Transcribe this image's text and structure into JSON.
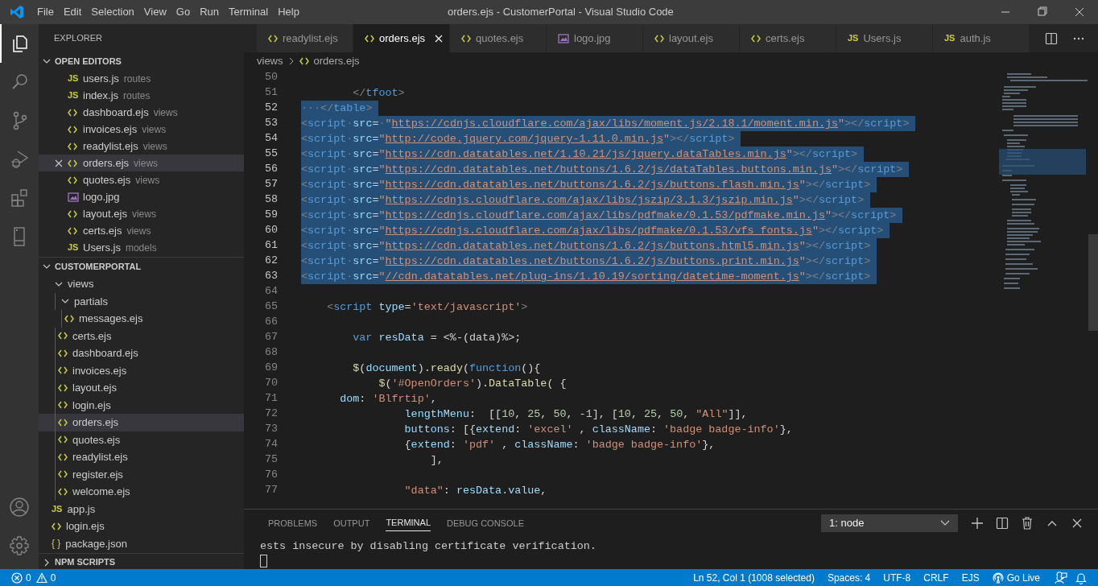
{
  "window": {
    "title": "orders.ejs - CustomerPortal - Visual Studio Code"
  },
  "menu": [
    "File",
    "Edit",
    "Selection",
    "View",
    "Go",
    "Run",
    "Terminal",
    "Help"
  ],
  "activity_bar": [
    {
      "kind": "explorer",
      "selected": true
    },
    {
      "kind": "search",
      "selected": false
    },
    {
      "kind": "source-control",
      "selected": false
    },
    {
      "kind": "run",
      "selected": false
    },
    {
      "kind": "extensions",
      "selected": false
    },
    {
      "kind": "remote",
      "selected": false
    }
  ],
  "activity_bar_bottom": [
    {
      "kind": "account"
    },
    {
      "kind": "settings"
    }
  ],
  "sidebar": {
    "title": "EXPLORER",
    "open_editors": {
      "title": "OPEN EDITORS",
      "expanded": true,
      "items": [
        {
          "label": "users.js",
          "folder": "routes",
          "kind": "js",
          "icon_label": "JS",
          "selected": false
        },
        {
          "label": "index.js",
          "folder": "routes",
          "kind": "js",
          "icon_label": "JS",
          "selected": false
        },
        {
          "label": "dashboard.ejs",
          "folder": "views",
          "kind": "ejs",
          "selected": false
        },
        {
          "label": "invoices.ejs",
          "folder": "views",
          "kind": "ejs",
          "selected": false
        },
        {
          "label": "readylist.ejs",
          "folder": "views",
          "kind": "ejs",
          "selected": false
        },
        {
          "label": "orders.ejs",
          "folder": "views",
          "kind": "ejs",
          "selected": true
        },
        {
          "label": "quotes.ejs",
          "folder": "views",
          "kind": "ejs",
          "selected": false
        },
        {
          "label": "logo.jpg",
          "kind": "image",
          "selected": false
        },
        {
          "label": "layout.ejs",
          "folder": "views",
          "kind": "ejs",
          "selected": false
        },
        {
          "label": "certs.ejs",
          "folder": "views",
          "kind": "ejs",
          "selected": false
        },
        {
          "label": "Users.js",
          "folder": "models",
          "kind": "js",
          "icon_label": "JS",
          "selected": false
        }
      ]
    },
    "project": {
      "title": "CUSTOMERPORTAL",
      "expanded": true,
      "tree": [
        {
          "label": "views",
          "kind": "folder",
          "expanded": true,
          "selected": false,
          "children": [
            {
              "label": "partials",
              "kind": "folder",
              "expanded": true,
              "selected": false,
              "children": [
                {
                  "label": "messages.ejs",
                  "kind": "ejs",
                  "selected": false
                }
              ]
            },
            {
              "label": "certs.ejs",
              "kind": "ejs",
              "selected": false
            },
            {
              "label": "dashboard.ejs",
              "kind": "ejs",
              "selected": false
            },
            {
              "label": "invoices.ejs",
              "kind": "ejs",
              "selected": false
            },
            {
              "label": "layout.ejs",
              "kind": "ejs",
              "selected": false
            },
            {
              "label": "login.ejs",
              "kind": "ejs",
              "selected": false
            },
            {
              "label": "orders.ejs",
              "kind": "ejs",
              "selected": true
            },
            {
              "label": "quotes.ejs",
              "kind": "ejs",
              "selected": false
            },
            {
              "label": "readylist.ejs",
              "kind": "ejs",
              "selected": false
            },
            {
              "label": "register.ejs",
              "kind": "ejs",
              "selected": false
            },
            {
              "label": "welcome.ejs",
              "kind": "ejs",
              "selected": false
            }
          ]
        },
        {
          "label": "app.js",
          "kind": "js",
          "icon_label": "JS",
          "selected": false
        },
        {
          "label": "login.ejs",
          "kind": "ejs",
          "selected": false
        },
        {
          "label": "package.json",
          "kind": "json",
          "icon_label": "{ }",
          "selected": false
        }
      ]
    },
    "npm_scripts": {
      "title": "NPM SCRIPTS",
      "expanded": false
    }
  },
  "tabs": [
    {
      "label": "readylist.ejs",
      "kind": "ejs",
      "selected": false
    },
    {
      "label": "orders.ejs",
      "kind": "ejs",
      "selected": true
    },
    {
      "label": "quotes.ejs",
      "kind": "ejs",
      "selected": false
    },
    {
      "label": "logo.jpg",
      "kind": "image",
      "selected": false
    },
    {
      "label": "layout.ejs",
      "kind": "ejs",
      "selected": false
    },
    {
      "label": "certs.ejs",
      "kind": "ejs",
      "selected": false
    },
    {
      "label": "Users.js",
      "kind": "js",
      "icon_label": "JS",
      "selected": false
    },
    {
      "label": "auth.js",
      "kind": "js",
      "icon_label": "JS",
      "selected": false
    }
  ],
  "breadcrumb": [
    "views",
    "orders.ejs"
  ],
  "editor": {
    "lines": [
      {
        "number": "50",
        "selected": false
      },
      {
        "number": "51",
        "selected": false,
        "tokens": [
          {
            "kind": "punct",
            "text": "        </"
          },
          {
            "kind": "tag",
            "text": "tfoot"
          },
          {
            "kind": "punct",
            "text": ">"
          }
        ]
      },
      {
        "number": "52",
        "selected": true,
        "tokens": [
          {
            "kind": "ws",
            "text": "···"
          },
          {
            "kind": "punct",
            "text": "</"
          },
          {
            "kind": "tag",
            "text": "table"
          },
          {
            "kind": "punct",
            "text": ">"
          }
        ]
      },
      {
        "number": "53",
        "selected": true,
        "tokens": [
          {
            "kind": "punct",
            "text": "<"
          },
          {
            "kind": "tag",
            "text": "script"
          },
          {
            "kind": "ws",
            "text": "·"
          },
          {
            "kind": "attr",
            "text": "src"
          },
          {
            "kind": "plain",
            "text": "="
          },
          {
            "kind": "ws",
            "text": "·"
          },
          {
            "kind": "str",
            "text": "\""
          },
          {
            "kind": "url",
            "text": "https://cdnjs.cloudflare.com/ajax/libs/moment.js/2.18.1/moment.min.js"
          },
          {
            "kind": "str",
            "text": "\""
          },
          {
            "kind": "punct",
            "text": "></"
          },
          {
            "kind": "tag",
            "text": "script"
          },
          {
            "kind": "punct",
            "text": ">"
          }
        ]
      },
      {
        "number": "54",
        "selected": true,
        "tokens": [
          {
            "kind": "punct",
            "text": "<"
          },
          {
            "kind": "tag",
            "text": "script"
          },
          {
            "kind": "ws",
            "text": "·"
          },
          {
            "kind": "attr",
            "text": "src"
          },
          {
            "kind": "plain",
            "text": "="
          },
          {
            "kind": "str",
            "text": "\""
          },
          {
            "kind": "url",
            "text": "http://code.jquery.com/jquery-1.11.0.min.js"
          },
          {
            "kind": "str",
            "text": "\""
          },
          {
            "kind": "punct",
            "text": "></"
          },
          {
            "kind": "tag",
            "text": "script"
          },
          {
            "kind": "punct",
            "text": ">"
          }
        ]
      },
      {
        "number": "55",
        "selected": true,
        "tokens": [
          {
            "kind": "punct",
            "text": "<"
          },
          {
            "kind": "tag",
            "text": "script"
          },
          {
            "kind": "ws",
            "text": "·"
          },
          {
            "kind": "attr",
            "text": "src"
          },
          {
            "kind": "plain",
            "text": "="
          },
          {
            "kind": "str",
            "text": "\""
          },
          {
            "kind": "url",
            "text": "https://cdn.datatables.net/1.10.21/js/jquery.dataTables.min.js"
          },
          {
            "kind": "str",
            "text": "\""
          },
          {
            "kind": "punct",
            "text": "></"
          },
          {
            "kind": "tag",
            "text": "script"
          },
          {
            "kind": "punct",
            "text": ">"
          }
        ]
      },
      {
        "number": "56",
        "selected": true,
        "tokens": [
          {
            "kind": "punct",
            "text": "<"
          },
          {
            "kind": "tag",
            "text": "script"
          },
          {
            "kind": "ws",
            "text": "·"
          },
          {
            "kind": "attr",
            "text": "src"
          },
          {
            "kind": "plain",
            "text": "="
          },
          {
            "kind": "str",
            "text": "\""
          },
          {
            "kind": "url",
            "text": "https://cdn.datatables.net/buttons/1.6.2/js/dataTables.buttons.min.js"
          },
          {
            "kind": "str",
            "text": "\""
          },
          {
            "kind": "punct",
            "text": "></"
          },
          {
            "kind": "tag",
            "text": "script"
          },
          {
            "kind": "punct",
            "text": ">"
          }
        ]
      },
      {
        "number": "57",
        "selected": true,
        "tokens": [
          {
            "kind": "punct",
            "text": "<"
          },
          {
            "kind": "tag",
            "text": "script"
          },
          {
            "kind": "ws",
            "text": "·"
          },
          {
            "kind": "attr",
            "text": "src"
          },
          {
            "kind": "plain",
            "text": "="
          },
          {
            "kind": "str",
            "text": "\""
          },
          {
            "kind": "url",
            "text": "https://cdn.datatables.net/buttons/1.6.2/js/buttons.flash.min.js"
          },
          {
            "kind": "str",
            "text": "\""
          },
          {
            "kind": "punct",
            "text": "></"
          },
          {
            "kind": "tag",
            "text": "script"
          },
          {
            "kind": "punct",
            "text": ">"
          }
        ]
      },
      {
        "number": "58",
        "selected": true,
        "tokens": [
          {
            "kind": "punct",
            "text": "<"
          },
          {
            "kind": "tag",
            "text": "script"
          },
          {
            "kind": "ws",
            "text": "·"
          },
          {
            "kind": "attr",
            "text": "src"
          },
          {
            "kind": "plain",
            "text": "="
          },
          {
            "kind": "str",
            "text": "\""
          },
          {
            "kind": "url",
            "text": "https://cdnjs.cloudflare.com/ajax/libs/jszip/3.1.3/jszip.min.js"
          },
          {
            "kind": "str",
            "text": "\""
          },
          {
            "kind": "punct",
            "text": "></"
          },
          {
            "kind": "tag",
            "text": "script"
          },
          {
            "kind": "punct",
            "text": ">"
          }
        ]
      },
      {
        "number": "59",
        "selected": true,
        "tokens": [
          {
            "kind": "punct",
            "text": "<"
          },
          {
            "kind": "tag",
            "text": "script"
          },
          {
            "kind": "ws",
            "text": "·"
          },
          {
            "kind": "attr",
            "text": "src"
          },
          {
            "kind": "plain",
            "text": "="
          },
          {
            "kind": "str",
            "text": "\""
          },
          {
            "kind": "url",
            "text": "https://cdnjs.cloudflare.com/ajax/libs/pdfmake/0.1.53/pdfmake.min.js"
          },
          {
            "kind": "str",
            "text": "\""
          },
          {
            "kind": "punct",
            "text": "></"
          },
          {
            "kind": "tag",
            "text": "script"
          },
          {
            "kind": "punct",
            "text": ">"
          }
        ]
      },
      {
        "number": "60",
        "selected": true,
        "tokens": [
          {
            "kind": "punct",
            "text": "<"
          },
          {
            "kind": "tag",
            "text": "script"
          },
          {
            "kind": "ws",
            "text": "·"
          },
          {
            "kind": "attr",
            "text": "src"
          },
          {
            "kind": "plain",
            "text": "="
          },
          {
            "kind": "str",
            "text": "\""
          },
          {
            "kind": "url",
            "text": "https://cdnjs.cloudflare.com/ajax/libs/pdfmake/0.1.53/vfs_fonts.js"
          },
          {
            "kind": "str",
            "text": "\""
          },
          {
            "kind": "punct",
            "text": "></"
          },
          {
            "kind": "tag",
            "text": "script"
          },
          {
            "kind": "punct",
            "text": ">"
          }
        ]
      },
      {
        "number": "61",
        "selected": true,
        "tokens": [
          {
            "kind": "punct",
            "text": "<"
          },
          {
            "kind": "tag",
            "text": "script"
          },
          {
            "kind": "ws",
            "text": "·"
          },
          {
            "kind": "attr",
            "text": "src"
          },
          {
            "kind": "plain",
            "text": "="
          },
          {
            "kind": "str",
            "text": "\""
          },
          {
            "kind": "url",
            "text": "https://cdn.datatables.net/buttons/1.6.2/js/buttons.html5.min.js"
          },
          {
            "kind": "str",
            "text": "\""
          },
          {
            "kind": "punct",
            "text": "></"
          },
          {
            "kind": "tag",
            "text": "script"
          },
          {
            "kind": "punct",
            "text": ">"
          }
        ]
      },
      {
        "number": "62",
        "selected": true,
        "tokens": [
          {
            "kind": "punct",
            "text": "<"
          },
          {
            "kind": "tag",
            "text": "script"
          },
          {
            "kind": "ws",
            "text": "·"
          },
          {
            "kind": "attr",
            "text": "src"
          },
          {
            "kind": "plain",
            "text": "="
          },
          {
            "kind": "str",
            "text": "\""
          },
          {
            "kind": "url",
            "text": "https://cdn.datatables.net/buttons/1.6.2/js/buttons.print.min.js"
          },
          {
            "kind": "str",
            "text": "\""
          },
          {
            "kind": "punct",
            "text": "></"
          },
          {
            "kind": "tag",
            "text": "script"
          },
          {
            "kind": "punct",
            "text": ">"
          }
        ]
      },
      {
        "number": "63",
        "selected": true,
        "tokens": [
          {
            "kind": "punct",
            "text": "<"
          },
          {
            "kind": "tag",
            "text": "script"
          },
          {
            "kind": "ws",
            "text": "·"
          },
          {
            "kind": "attr",
            "text": "src"
          },
          {
            "kind": "plain",
            "text": "="
          },
          {
            "kind": "str",
            "text": "\""
          },
          {
            "kind": "url",
            "text": "//cdn.datatables.net/plug-ins/1.10.19/sorting/datetime-moment.js"
          },
          {
            "kind": "str",
            "text": "\""
          },
          {
            "kind": "punct",
            "text": "></"
          },
          {
            "kind": "tag",
            "text": "script"
          },
          {
            "kind": "punct",
            "text": ">"
          }
        ]
      },
      {
        "number": "64",
        "selected": false
      },
      {
        "number": "65",
        "selected": false,
        "tokens": [
          {
            "kind": "punct",
            "text": "    <"
          },
          {
            "kind": "tag",
            "text": "script"
          },
          {
            "kind": "attr",
            "text": " type"
          },
          {
            "kind": "plain",
            "text": "="
          },
          {
            "kind": "str",
            "text": "'text/javascript'"
          },
          {
            "kind": "punct",
            "text": ">"
          }
        ]
      },
      {
        "number": "66",
        "selected": false
      },
      {
        "number": "67",
        "selected": false,
        "tokens": [
          {
            "kind": "keyword",
            "text": "        var"
          },
          {
            "kind": "attr",
            "text": " resData"
          },
          {
            "kind": "plain",
            "text": " = <%-(data)%>;"
          }
        ]
      },
      {
        "number": "68",
        "selected": false
      },
      {
        "number": "69",
        "selected": false,
        "tokens": [
          {
            "kind": "func",
            "text": "        $"
          },
          {
            "kind": "plain",
            "text": "("
          },
          {
            "kind": "attr",
            "text": "document"
          },
          {
            "kind": "plain",
            "text": ")."
          },
          {
            "kind": "func",
            "text": "ready"
          },
          {
            "kind": "plain",
            "text": "("
          },
          {
            "kind": "keyword",
            "text": "function"
          },
          {
            "kind": "plain",
            "text": "(){"
          }
        ]
      },
      {
        "number": "70",
        "selected": false,
        "tokens": [
          {
            "kind": "func",
            "text": "            $"
          },
          {
            "kind": "plain",
            "text": "("
          },
          {
            "kind": "str",
            "text": "'#OpenOrders'"
          },
          {
            "kind": "plain",
            "text": ")."
          },
          {
            "kind": "func",
            "text": "DataTable"
          },
          {
            "kind": "plain",
            "text": "( {"
          }
        ]
      },
      {
        "number": "71",
        "selected": false,
        "tokens": [
          {
            "kind": "attr",
            "text": "      dom"
          },
          {
            "kind": "plain",
            "text": ": "
          },
          {
            "kind": "str",
            "text": "'Blfrtip'"
          },
          {
            "kind": "plain",
            "text": ","
          }
        ]
      },
      {
        "number": "72",
        "selected": false,
        "tokens": [
          {
            "kind": "attr",
            "text": "                lengthMenu"
          },
          {
            "kind": "plain",
            "text": ":  [["
          },
          {
            "kind": "num",
            "text": "10"
          },
          {
            "kind": "plain",
            "text": ", "
          },
          {
            "kind": "num",
            "text": "25"
          },
          {
            "kind": "plain",
            "text": ", "
          },
          {
            "kind": "num",
            "text": "50"
          },
          {
            "kind": "plain",
            "text": ", -"
          },
          {
            "kind": "num",
            "text": "1"
          },
          {
            "kind": "plain",
            "text": "], ["
          },
          {
            "kind": "num",
            "text": "10"
          },
          {
            "kind": "plain",
            "text": ", "
          },
          {
            "kind": "num",
            "text": "25"
          },
          {
            "kind": "plain",
            "text": ", "
          },
          {
            "kind": "num",
            "text": "50"
          },
          {
            "kind": "plain",
            "text": ", "
          },
          {
            "kind": "str",
            "text": "\"All\""
          },
          {
            "kind": "plain",
            "text": "]],"
          }
        ]
      },
      {
        "number": "73",
        "selected": false,
        "tokens": [
          {
            "kind": "attr",
            "text": "                buttons"
          },
          {
            "kind": "plain",
            "text": ": [{"
          },
          {
            "kind": "attr",
            "text": "extend"
          },
          {
            "kind": "plain",
            "text": ": "
          },
          {
            "kind": "str",
            "text": "'excel'"
          },
          {
            "kind": "plain",
            "text": " , "
          },
          {
            "kind": "attr",
            "text": "className"
          },
          {
            "kind": "plain",
            "text": ": "
          },
          {
            "kind": "str",
            "text": "'badge badge-info'"
          },
          {
            "kind": "plain",
            "text": "},"
          }
        ]
      },
      {
        "number": "74",
        "selected": false,
        "tokens": [
          {
            "kind": "plain",
            "text": "                {"
          },
          {
            "kind": "attr",
            "text": "extend"
          },
          {
            "kind": "plain",
            "text": ": "
          },
          {
            "kind": "str",
            "text": "'pdf'"
          },
          {
            "kind": "plain",
            "text": " , "
          },
          {
            "kind": "attr",
            "text": "className"
          },
          {
            "kind": "plain",
            "text": ": "
          },
          {
            "kind": "str",
            "text": "'badge badge-info'"
          },
          {
            "kind": "plain",
            "text": "},"
          }
        ]
      },
      {
        "number": "75",
        "selected": false,
        "tokens": [
          {
            "kind": "plain",
            "text": "                    ],"
          }
        ]
      },
      {
        "number": "76",
        "selected": false
      },
      {
        "number": "77",
        "selected": false,
        "tokens": [
          {
            "kind": "str",
            "text": "                \"data\""
          },
          {
            "kind": "plain",
            "text": ": "
          },
          {
            "kind": "attr",
            "text": "resData"
          },
          {
            "kind": "plain",
            "text": "."
          },
          {
            "kind": "attr",
            "text": "value"
          },
          {
            "kind": "plain",
            "text": ","
          }
        ]
      }
    ]
  },
  "panel": {
    "tabs": [
      {
        "label": "PROBLEMS",
        "selected": false
      },
      {
        "label": "OUTPUT",
        "selected": false
      },
      {
        "label": "TERMINAL",
        "selected": true
      },
      {
        "label": "DEBUG CONSOLE",
        "selected": false
      }
    ],
    "terminal_select": "1: node",
    "terminal_lines": [
      "ests insecure by disabling certificate verification."
    ]
  },
  "status_bar": {
    "errors": "0",
    "warnings": "0",
    "items": [
      "Ln 52, Col 1 (1008 selected)",
      "Spaces: 4",
      "UTF-8",
      "CRLF",
      "EJS"
    ],
    "go_live": "Go Live"
  }
}
